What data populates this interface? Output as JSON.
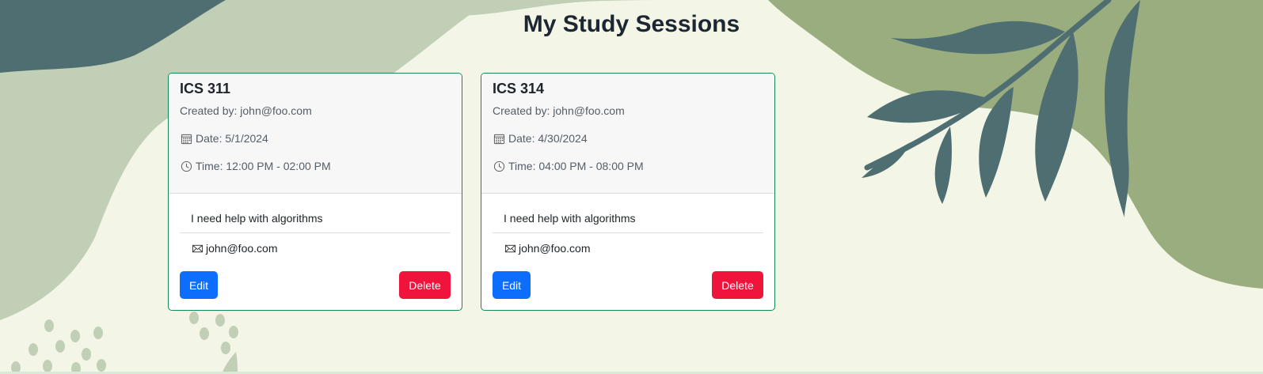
{
  "page": {
    "title": "My Study Sessions"
  },
  "colors": {
    "background": "#f3f5e6",
    "card_border": "#198754",
    "edit_button": "#0d6efd",
    "delete_button": "#f0143c",
    "teal_shape": "#4e6e72",
    "sage_shape": "#c1cfb6",
    "olive_shape": "#9aad7e"
  },
  "sessions": [
    {
      "title": "ICS 311",
      "created_by": "Created by: john@foo.com",
      "date": "Date: 5/1/2024",
      "time": "Time: 12:00 PM - 02:00 PM",
      "description": "I need help with algorithms",
      "email": "john@foo.com",
      "edit_label": "Edit",
      "delete_label": "Delete"
    },
    {
      "title": "ICS 314",
      "created_by": "Created by: john@foo.com",
      "date": "Date: 4/30/2024",
      "time": "Time: 04:00 PM - 08:00 PM",
      "description": "I need help with algorithms",
      "email": "john@foo.com",
      "edit_label": "Edit",
      "delete_label": "Delete"
    }
  ],
  "icons": {
    "date": "calendar-icon",
    "time": "clock-icon",
    "email": "envelope-icon"
  }
}
